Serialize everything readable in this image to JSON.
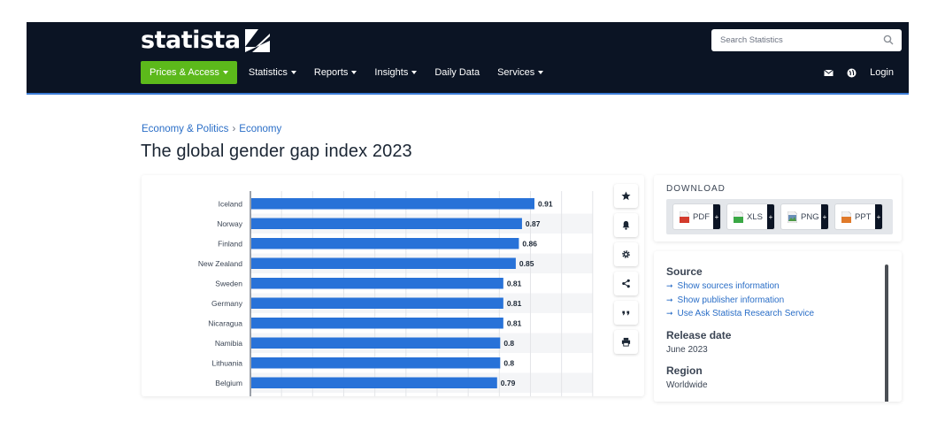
{
  "header": {
    "logo_text": "statista",
    "search_placeholder": "Search Statistics",
    "nav": [
      {
        "label": "Prices & Access",
        "has_caret": true,
        "primary": true
      },
      {
        "label": "Statistics",
        "has_caret": true
      },
      {
        "label": "Reports",
        "has_caret": true
      },
      {
        "label": "Insights",
        "has_caret": true
      },
      {
        "label": "Daily Data",
        "has_caret": false
      },
      {
        "label": "Services",
        "has_caret": true
      }
    ],
    "login_label": "Login",
    "colors": {
      "background": "#0b1424",
      "primary_button": "#5cb91b"
    }
  },
  "breadcrumb": {
    "items": [
      "Economy & Politics",
      "Economy"
    ],
    "separator": "›"
  },
  "page_title": "The global gender gap index 2023",
  "chart_data": {
    "type": "bar",
    "orientation": "horizontal",
    "categories": [
      "Iceland",
      "Norway",
      "Finland",
      "New Zealand",
      "Sweden",
      "Germany",
      "Nicaragua",
      "Namibia",
      "Lithuania",
      "Belgium"
    ],
    "values": [
      0.91,
      0.87,
      0.86,
      0.85,
      0.81,
      0.81,
      0.81,
      0.8,
      0.8,
      0.79
    ],
    "value_labels": [
      "0.91",
      "0.87",
      "0.86",
      "0.85",
      "0.81",
      "0.81",
      "0.81",
      "0.8",
      "0.8",
      "0.79"
    ],
    "xlim": [
      0,
      1.1
    ],
    "grid": true,
    "bar_color": "#2872d8"
  },
  "tools": [
    {
      "name": "favorite-icon"
    },
    {
      "name": "notification-icon"
    },
    {
      "name": "settings-icon"
    },
    {
      "name": "share-icon"
    },
    {
      "name": "cite-icon"
    },
    {
      "name": "print-icon"
    }
  ],
  "download": {
    "title": "DOWNLOAD",
    "buttons": [
      {
        "label": "PDF",
        "icon": "pdf-file-icon",
        "color": "#d33b2c"
      },
      {
        "label": "XLS",
        "icon": "xls-file-icon",
        "color": "#3aa845"
      },
      {
        "label": "PNG",
        "icon": "png-file-icon",
        "color": "#6a8fb8"
      },
      {
        "label": "PPT",
        "icon": "ppt-file-icon",
        "color": "#e07a2a"
      }
    ],
    "plus_label": "+"
  },
  "info": {
    "source_title": "Source",
    "links": [
      "Show sources information",
      "Show publisher information",
      "Use Ask Statista Research Service"
    ],
    "release_title": "Release date",
    "release_value": "June 2023",
    "region_title": "Region",
    "region_value": "Worldwide"
  }
}
